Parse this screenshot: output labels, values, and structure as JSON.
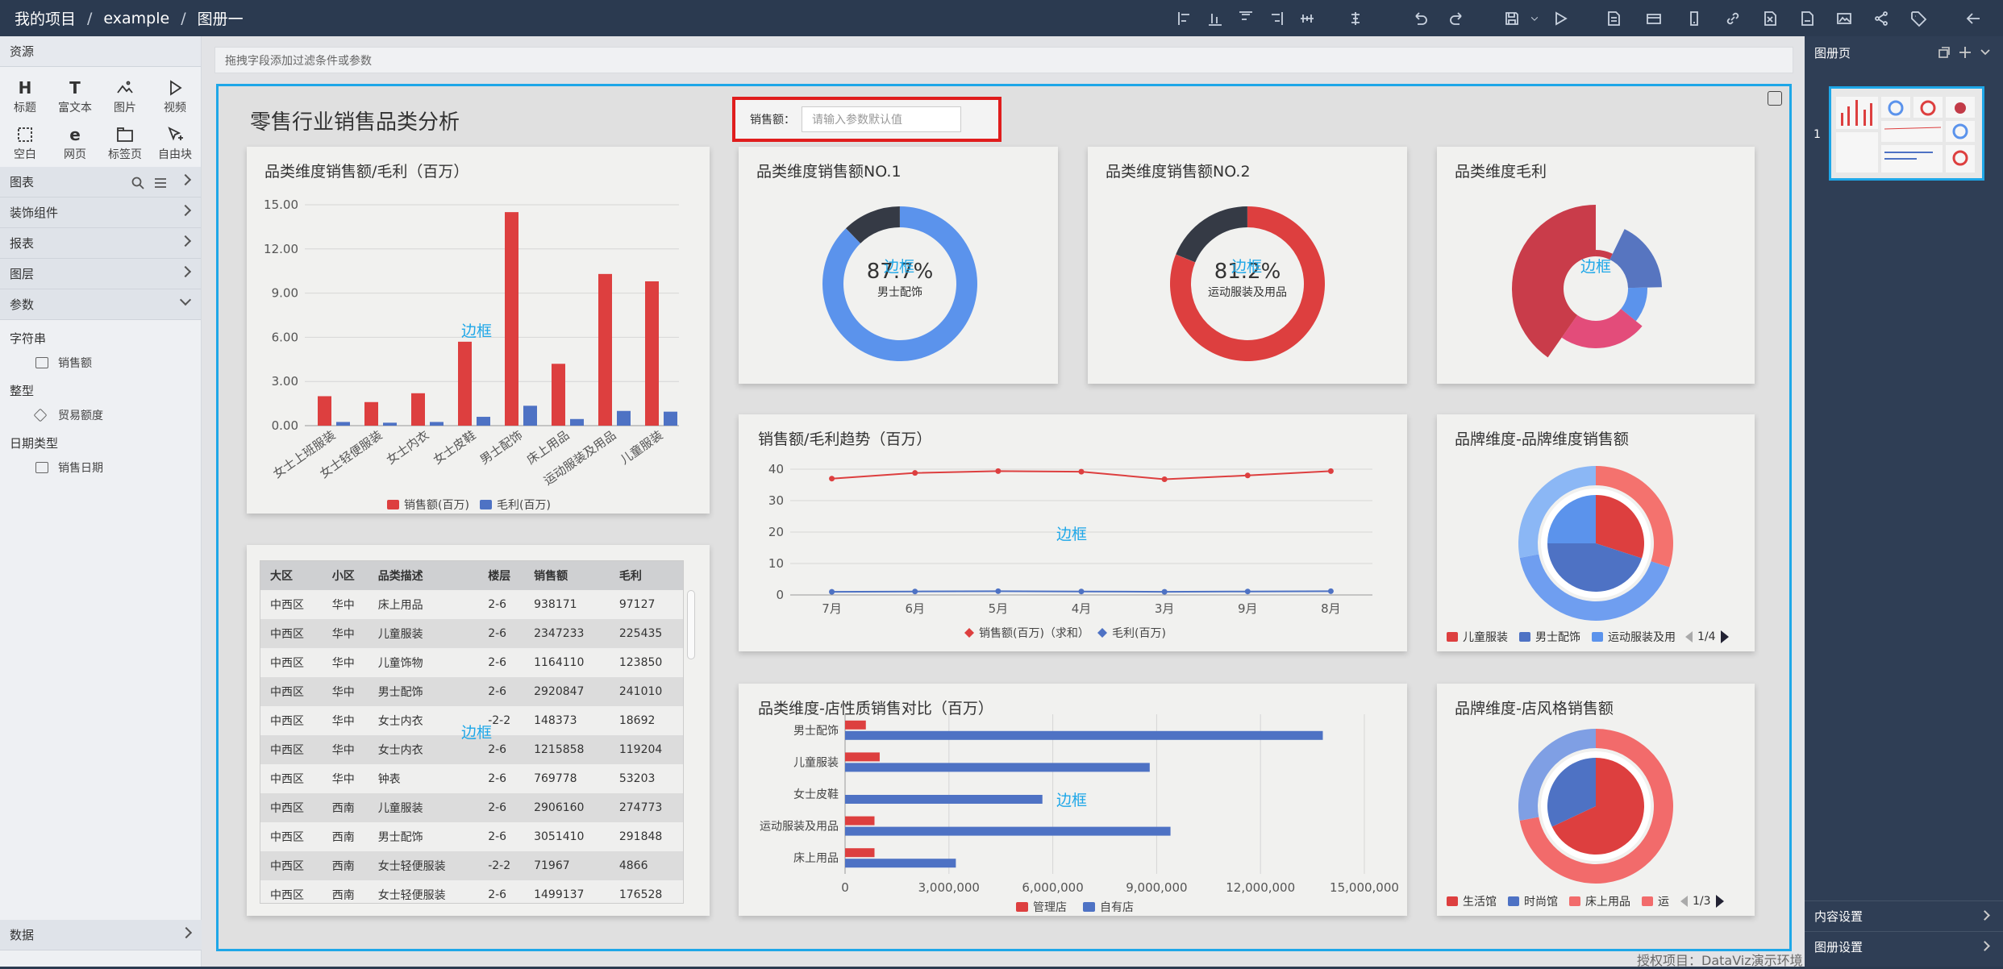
{
  "breadcrumb": {
    "project": "我的项目",
    "sep": "/",
    "item": "example",
    "book": "图册一"
  },
  "left": {
    "resources": "资源",
    "components": [
      {
        "label": "标题",
        "icon": "heading-icon"
      },
      {
        "label": "富文本",
        "icon": "richtext-icon"
      },
      {
        "label": "图片",
        "icon": "image-icon"
      },
      {
        "label": "视频",
        "icon": "video-icon"
      },
      {
        "label": "空白",
        "icon": "blank-icon"
      },
      {
        "label": "网页",
        "icon": "webpage-icon"
      },
      {
        "label": "标签页",
        "icon": "tabpage-icon"
      },
      {
        "label": "自由块",
        "icon": "freeblock-icon"
      }
    ],
    "sections": {
      "chart": "图表",
      "decoration": "装饰组件",
      "report": "报表",
      "layer": "图层",
      "params": "参数",
      "data": "数据"
    },
    "param_groups": [
      {
        "type": "字符串",
        "item": "销售额"
      },
      {
        "type": "整型",
        "item": "贸易额度"
      },
      {
        "type": "日期类型",
        "item": "销售日期"
      }
    ]
  },
  "filterbar": {
    "hint": "拖拽字段添加过滤条件或参数"
  },
  "dashboard": {
    "title": "零售行业销售品类分析",
    "param_label": "销售额：",
    "param_placeholder": "请输入参数默认值",
    "border_label": "边框"
  },
  "cards": {
    "bar": {
      "title": "品类维度销售额/毛利（百万）"
    },
    "donut1": {
      "title": "品类维度销售额NO.1",
      "value": "87.7%",
      "sub": "男士配饰"
    },
    "donut2": {
      "title": "品类维度销售额NO.2",
      "value": "81.2%",
      "sub": "运动服装及用品"
    },
    "rose": {
      "title": "品类维度毛利"
    },
    "trend": {
      "title": "销售额/毛利趋势（百万）"
    },
    "brand1": {
      "title": "品牌维度-品牌维度销售额",
      "legend": [
        "儿童服装",
        "男士配饰",
        "运动服装及用"
      ],
      "page": "1/4"
    },
    "hbar": {
      "title": "品类维度-店性质销售对比（百万）"
    },
    "brand2": {
      "title": "品牌维度-店风格销售额",
      "legend": [
        "生活馆",
        "时尚馆",
        "床上用品",
        "运"
      ],
      "page": "1/3"
    }
  },
  "table": {
    "headers": [
      "大区",
      "小区",
      "品类描述",
      "楼层",
      "销售额",
      "毛利"
    ],
    "rows": [
      [
        "中西区",
        "华中",
        "床上用品",
        "2-6",
        "938171",
        "97127"
      ],
      [
        "中西区",
        "华中",
        "儿童服装",
        "2-6",
        "2347233",
        "225435"
      ],
      [
        "中西区",
        "华中",
        "儿童饰物",
        "2-6",
        "1164110",
        "123850"
      ],
      [
        "中西区",
        "华中",
        "男士配饰",
        "2-6",
        "2920847",
        "241010"
      ],
      [
        "中西区",
        "华中",
        "女士内衣",
        "-2-2",
        "148373",
        "18692"
      ],
      [
        "中西区",
        "华中",
        "女士内衣",
        "2-6",
        "1215858",
        "119204"
      ],
      [
        "中西区",
        "华中",
        "钟表",
        "2-6",
        "769778",
        "53203"
      ],
      [
        "中西区",
        "西南",
        "儿童服装",
        "2-6",
        "2906160",
        "274773"
      ],
      [
        "中西区",
        "西南",
        "男士配饰",
        "2-6",
        "3051410",
        "291848"
      ],
      [
        "中西区",
        "西南",
        "女士轻便服装",
        "-2-2",
        "71967",
        "4866"
      ],
      [
        "中西区",
        "西南",
        "女士轻便服装",
        "2-6",
        "1499137",
        "176528"
      ]
    ]
  },
  "right": {
    "title": "图册页",
    "page_num": "1",
    "content_settings": "内容设置",
    "page_settings": "图册设置"
  },
  "footer": "授权项目：DataViz演示环境",
  "chart_data": [
    {
      "type": "bar",
      "title": "品类维度销售额/毛利（百万）",
      "categories": [
        "女士上班服装",
        "女士轻便服装",
        "女士内衣",
        "女士皮鞋",
        "男士配饰",
        "床上用品",
        "运动服装及用品",
        "儿童服装"
      ],
      "series": [
        {
          "name": "销售额(百万)",
          "values": [
            2.0,
            1.6,
            2.2,
            5.7,
            14.5,
            4.2,
            10.3,
            9.8
          ],
          "color": "#dd3f3f"
        },
        {
          "name": "毛利(百万)",
          "values": [
            0.25,
            0.2,
            0.25,
            0.6,
            1.35,
            0.45,
            1.0,
            0.95
          ],
          "color": "#4e72c4"
        }
      ],
      "yticks": [
        "0.00",
        "3.00",
        "6.00",
        "9.00",
        "12.00",
        "15.00"
      ],
      "ylim": [
        0,
        15
      ]
    },
    {
      "type": "line",
      "title": "销售额/毛利趋势（百万）",
      "categories": [
        "7月",
        "6月",
        "5月",
        "4月",
        "3月",
        "9月",
        "8月"
      ],
      "series": [
        {
          "name": "销售额(百万)（求和）",
          "values": [
            37,
            38.8,
            39.4,
            39.2,
            36.8,
            38,
            39.4
          ],
          "color": "#dd3f3f"
        },
        {
          "name": "毛利(百万)",
          "values": [
            1,
            1.1,
            1.2,
            1.1,
            1,
            1.1,
            1.2
          ],
          "color": "#4e72c4"
        }
      ],
      "yticks": [
        "0",
        "10",
        "20",
        "30",
        "40"
      ],
      "ylim": [
        0,
        40
      ]
    },
    {
      "type": "bar",
      "title": "品类维度-店性质销售对比（百万）",
      "categories": [
        "男士配饰",
        "儿童服装",
        "女士皮鞋",
        "运动服装及用品",
        "床上用品"
      ],
      "series": [
        {
          "name": "管理店",
          "values": [
            600000,
            1000000,
            0,
            850000,
            850000
          ],
          "color": "#dd3f3f"
        },
        {
          "name": "自有店",
          "values": [
            13800000,
            8800000,
            5700000,
            9400000,
            3200000
          ],
          "color": "#4e72c4"
        }
      ],
      "xticks": [
        "0",
        "3,000,000",
        "6,000,000",
        "9,000,000",
        "12,000,000",
        "15,000,000"
      ],
      "xlim": [
        0,
        15000000
      ]
    },
    {
      "type": "pie",
      "title": "品类维度销售额NO.1",
      "values": [
        87.7,
        12.3
      ],
      "colors": [
        "#5b93ec",
        "#353a45"
      ]
    },
    {
      "type": "pie",
      "title": "品类维度销售额NO.2",
      "values": [
        81.2,
        18.8
      ],
      "colors": [
        "#dd3f3f",
        "#353a45"
      ]
    }
  ]
}
